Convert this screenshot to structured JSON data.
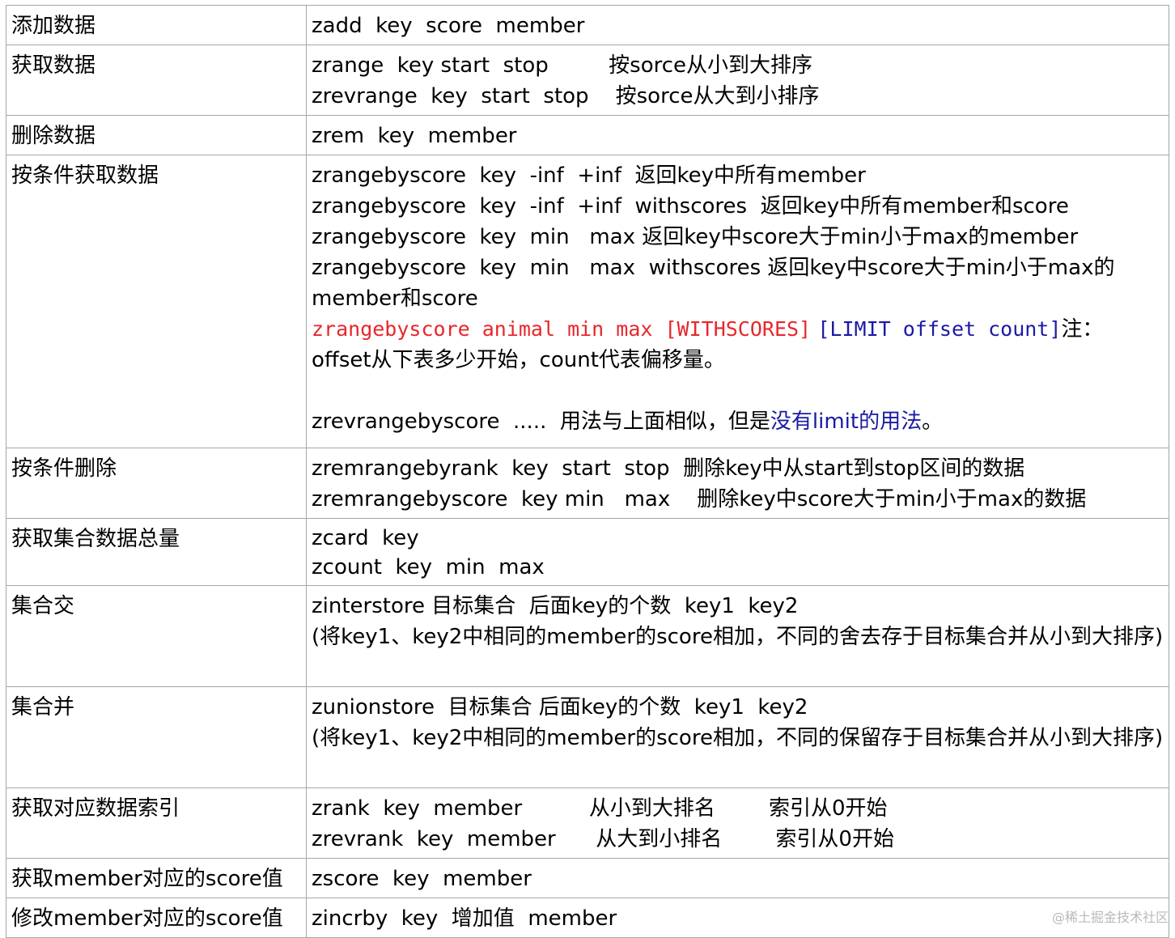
{
  "rows": [
    {
      "label": "添加数据",
      "lines": [
        "zadd  key  score  member"
      ]
    },
    {
      "label": "获取数据",
      "lines": [
        "zrange  key start  stop         按sorce从小到大排序",
        "zrevrange  key  start  stop    按sorce从大到小排序"
      ]
    },
    {
      "label": "删除数据",
      "lines": [
        "zrem  key  member"
      ]
    },
    {
      "label": "按条件获取数据",
      "lines": [
        "zrangebyscore  key  -inf  +inf  返回key中所有member",
        "zrangebyscore  key  -inf  +inf  withscores  返回key中所有member和score",
        "zrangebyscore  key  min   max 返回key中score大于min小于max的member",
        "zrangebyscore  key  min   max  withscores 返回key中score大于min小于max的",
        "member和score"
      ],
      "red_part": "zrangebyscore animal min max [WITHSCORES]",
      "blue_part": "[LIMIT offset count]",
      "note_part": "注：",
      "note_line2": "offset从下表多少开始，count代表偏移量。",
      "rev_prefix": "zrevrangebyscore  .....  用法与上面相似，但是",
      "rev_blue": "没有limit的用法",
      "rev_suffix": "。"
    },
    {
      "label": "按条件删除",
      "lines": [
        "zremrangebyrank  key  start  stop  删除key中从start到stop区间的数据",
        "zremrangebyscore  key min   max    删除key中score大于min小于max的数据"
      ]
    },
    {
      "label": "获取集合数据总量",
      "lines": [
        "zcard  key",
        "zcount  key  min  max"
      ]
    },
    {
      "label": "集合交",
      "lines": [
        "zinterstore 目标集合  后面key的个数  key1  key2"
      ],
      "wrap": " (将key1、key2中相同的member的score相加，不同的舍去存于目标集合并从小到大排序)"
    },
    {
      "label": "集合并",
      "lines": [
        "zunionstore  目标集合 后面key的个数  key1  key2"
      ],
      "wrap": "(将key1、key2中相同的member的score相加，不同的保留存于目标集合并从小到大排序)"
    },
    {
      "label": "获取对应数据索引",
      "lines": [
        "zrank  key  member          从小到大排名        索引从0开始",
        "zrevrank  key  member      从大到小排名        索引从0开始"
      ]
    },
    {
      "label": "获取member对应的score值",
      "lines": [
        "zscore  key  member"
      ]
    },
    {
      "label": "修改member对应的score值",
      "lines": [
        "zincrby  key  增加值  member"
      ]
    }
  ],
  "watermark": "@稀土掘金技术社区"
}
